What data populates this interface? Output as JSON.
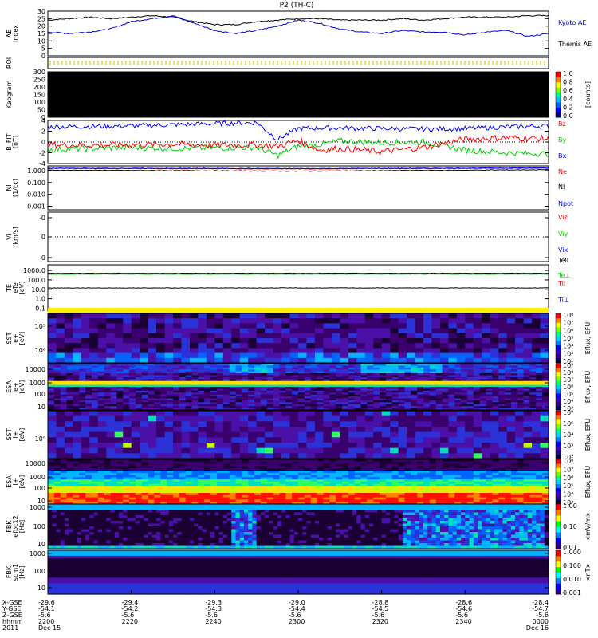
{
  "title": "P2 (TH-C)",
  "colors": {
    "kyoto": "#0000cc",
    "themis": "#000000",
    "bz": "#ff0000",
    "by": "#00cc00",
    "bx": "#0000ff",
    "ne": "#ff0000",
    "ni": "#000000",
    "npot": "#0000ff",
    "vx": "#0000ff",
    "vy": "#00cc00",
    "vz": "#ff0000",
    "te_perp": "#00cc00",
    "ti": "#ff0000",
    "ti_perp": "#0000ff"
  },
  "chart_data": [
    {
      "type": "line",
      "panel": "ae",
      "ylabel": "AE Index",
      "ylim": [
        0,
        30
      ],
      "yticks": [
        "0",
        "5",
        "10",
        "15",
        "20",
        "25",
        "30"
      ],
      "series": [
        {
          "name": "Kyoto AE",
          "x": [
            0,
            5,
            10,
            15,
            20,
            25,
            30,
            35,
            40,
            45,
            50,
            55,
            60,
            65,
            70,
            75,
            80,
            85,
            90,
            95,
            100,
            105,
            110,
            115,
            120
          ],
          "values": [
            16,
            15,
            16,
            18,
            23,
            25,
            27,
            22,
            17,
            15,
            17,
            20,
            24,
            22,
            18,
            16,
            15,
            17,
            16,
            16,
            14,
            16,
            17,
            13,
            15
          ]
        },
        {
          "name": "Themis AE",
          "x": [
            0,
            5,
            10,
            15,
            20,
            25,
            30,
            35,
            40,
            45,
            50,
            55,
            60,
            65,
            70,
            75,
            80,
            85,
            90,
            95,
            100,
            105,
            110,
            115,
            120
          ],
          "values": [
            24,
            25,
            26,
            25,
            26,
            27,
            26,
            23,
            21,
            21,
            23,
            24,
            25,
            25,
            24,
            24,
            24,
            25,
            24,
            25,
            26,
            26,
            26,
            27,
            27
          ]
        }
      ]
    },
    {
      "type": "heatmap",
      "panel": "roi",
      "ylabel": "ROI"
    },
    {
      "type": "heatmap",
      "panel": "keogram",
      "ylabel": "Keogram",
      "yticks": [
        "0",
        "50",
        "100",
        "150",
        "200",
        "250",
        "300"
      ],
      "colorbar": {
        "ticks": [
          "0.0",
          "0.2",
          "0.4",
          "0.6",
          "0.8",
          "1.0"
        ],
        "label": "[counts]"
      }
    },
    {
      "type": "line",
      "panel": "bfield",
      "ylabel": "B_FIT [nT]",
      "ylim": [
        -4,
        4
      ],
      "yticks": [
        "-4",
        "-2",
        "0",
        "2",
        "4"
      ],
      "series": [
        {
          "name": "Bz",
          "x": [
            0,
            10,
            20,
            30,
            40,
            50,
            55,
            60,
            65,
            70,
            80,
            90,
            100,
            110,
            120
          ],
          "values": [
            -0.5,
            -0.6,
            -0.5,
            -0.4,
            -0.6,
            -0.5,
            -0.8,
            0.3,
            -1.5,
            -1.2,
            -1.8,
            -1.0,
            0.5,
            0.8,
            0.6
          ]
        },
        {
          "name": "By",
          "x": [
            0,
            10,
            20,
            30,
            40,
            50,
            55,
            60,
            65,
            70,
            80,
            90,
            100,
            110,
            120
          ],
          "values": [
            -1.4,
            -1.2,
            -1.0,
            -1.2,
            -1.1,
            -1.0,
            -2.5,
            -0.8,
            -0.5,
            0.2,
            -0.1,
            0.0,
            -1.5,
            -2.0,
            -2.2
          ]
        },
        {
          "name": "Bx",
          "x": [
            0,
            10,
            20,
            30,
            40,
            50,
            55,
            60,
            65,
            70,
            80,
            90,
            100,
            110,
            120
          ],
          "values": [
            2.8,
            2.9,
            3.0,
            3.2,
            3.4,
            3.6,
            0.5,
            2.5,
            2.6,
            2.6,
            2.5,
            2.4,
            2.5,
            2.8,
            3.0
          ]
        }
      ]
    },
    {
      "type": "line",
      "panel": "density",
      "ylabel": "NI [1/cc]",
      "yticks": [
        "0.001",
        "0.010",
        "0.100",
        "1.000"
      ],
      "series": [
        {
          "name": "Ne",
          "x": [
            0,
            60,
            120
          ],
          "values": [
            1.5,
            1.4,
            1.6
          ]
        },
        {
          "name": "NI",
          "x": [
            0,
            60,
            120
          ],
          "values": [
            1.1,
            0.9,
            1.2
          ]
        },
        {
          "name": "Npot",
          "x": [
            0,
            60,
            120
          ],
          "values": [
            1.6,
            1.5,
            1.7
          ]
        }
      ]
    },
    {
      "type": "line",
      "panel": "velocity",
      "ylabel": "Vi [km/s]",
      "yticks": [
        "-0",
        "0",
        "-0"
      ],
      "series": [
        {
          "name": "Viz",
          "x": [
            0,
            120
          ],
          "values": [
            0,
            0
          ]
        },
        {
          "name": "Viy",
          "x": [
            0,
            120
          ],
          "values": [
            0,
            0
          ]
        },
        {
          "name": "Vix",
          "x": [
            0,
            120
          ],
          "values": [
            0,
            0
          ]
        }
      ]
    },
    {
      "type": "line",
      "panel": "temperature",
      "ylabel": "TE eTe [eV]",
      "yticks": [
        "0.1",
        "1.0",
        "10.0",
        "100.0",
        "1000.0"
      ],
      "series": [
        {
          "name": "TeII",
          "x": [
            0,
            120
          ],
          "values": [
            500,
            500
          ]
        },
        {
          "name": "Te⊥",
          "x": [
            0,
            120
          ],
          "values": [
            400,
            400
          ]
        },
        {
          "name": "TiI",
          "x": [
            0,
            120
          ],
          "values": [
            20,
            20
          ]
        },
        {
          "name": "Ti⊥",
          "x": [
            0,
            120
          ],
          "values": [
            15,
            15
          ]
        }
      ]
    },
    {
      "type": "heatmap",
      "panel": "sst_e",
      "ylabel": "SST e+ [eV]",
      "yticks": [
        "10⁵",
        "10⁶"
      ],
      "colorbar": {
        "ticks": [
          "10²",
          "10³",
          "10⁴",
          "10⁵",
          "10⁶",
          "10⁷",
          "10⁸"
        ],
        "label": "Eflux, EFU"
      }
    },
    {
      "type": "heatmap",
      "panel": "esa_e",
      "ylabel": "ESA e+ [eV]",
      "yticks": [
        "10",
        "100",
        "1000",
        "10000"
      ],
      "colorbar": {
        "ticks": [
          "10³",
          "10⁴",
          "10⁵",
          "10⁶",
          "10⁷",
          "10⁸",
          "10⁹"
        ],
        "label": "Eflux, EFU"
      }
    },
    {
      "type": "heatmap",
      "panel": "sst_i",
      "ylabel": "SST i+ [eV]",
      "yticks": [
        "10⁵"
      ],
      "colorbar": {
        "ticks": [
          "10²",
          "10³",
          "10⁴",
          "10⁵",
          "10⁶"
        ],
        "label": "Eflux, EFU"
      }
    },
    {
      "type": "heatmap",
      "panel": "esa_i",
      "ylabel": "ESA i+ [eV]",
      "yticks": [
        "10",
        "100",
        "1000",
        "10000"
      ],
      "colorbar": {
        "ticks": [
          "10³",
          "10⁴",
          "10⁵",
          "10⁶",
          "10⁷",
          "10⁸"
        ],
        "label": "Eflux, EFU"
      }
    },
    {
      "type": "heatmap",
      "panel": "fbk_e",
      "ylabel": "FBK efpc12 [Hz]",
      "yticks": [
        "10",
        "100",
        "1000"
      ],
      "colorbar": {
        "ticks": [
          "0.01",
          "0.10",
          "1.00"
        ],
        "label": "<mV/m>"
      }
    },
    {
      "type": "heatmap",
      "panel": "fbk_b",
      "ylabel": "FBK scm1 [Hz]",
      "yticks": [
        "10",
        "100",
        "1000"
      ],
      "colorbar": {
        "ticks": [
          "0.001",
          "0.010",
          "0.100",
          "1.000"
        ],
        "label": "<nT>"
      }
    }
  ],
  "legend": {
    "ae": [
      "Kyoto AE",
      "Themis AE"
    ],
    "bfield": [
      "Bz",
      "By",
      "Bx"
    ],
    "density": [
      "Ne",
      "NI",
      "Npot"
    ],
    "velocity": [
      "Viz",
      "Viy",
      "Vix"
    ],
    "temperature": [
      "TeII",
      "Te⊥",
      "TiI",
      "Ti⊥"
    ]
  },
  "time_axis": {
    "row_labels": [
      "X-GSE",
      "Y-GSE",
      "Z-GSE",
      "hhmm",
      "2011"
    ],
    "ticks": [
      {
        "x": "-29.6",
        "y": "-54.1",
        "z": "-5.6",
        "hhmm": "2200",
        "date": "Dec 15"
      },
      {
        "x": "-29.4",
        "y": "-54.2",
        "z": "-5.6",
        "hhmm": "2220",
        "date": ""
      },
      {
        "x": "-29.3",
        "y": "-54.3",
        "z": "-5.6",
        "hhmm": "2240",
        "date": ""
      },
      {
        "x": "-29.0",
        "y": "-54.4",
        "z": "-5.6",
        "hhmm": "2300",
        "date": ""
      },
      {
        "x": "-28.8",
        "y": "-54.5",
        "z": "-5.6",
        "hhmm": "2320",
        "date": ""
      },
      {
        "x": "-28.6",
        "y": "-54.6",
        "z": "-5.6",
        "hhmm": "2340",
        "date": ""
      },
      {
        "x": "-28.4",
        "y": "-54.7",
        "z": "-5.6",
        "hhmm": "0000",
        "date": "Dec 16"
      }
    ]
  }
}
